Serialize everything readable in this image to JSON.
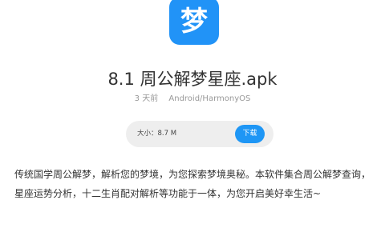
{
  "colors": {
    "accent": "#2193f7",
    "button": "#1e96f5",
    "text": "#333333",
    "muted": "#999999",
    "bar_bg": "#eeeeee"
  },
  "app": {
    "icon_name": "dream-logo-icon",
    "icon_glyph": "梦",
    "title": "8.1 周公解梦星座.apk",
    "time_ago": "3 天前",
    "platform": "Android/HarmonyOS"
  },
  "download": {
    "size_label": "大小：8.7 M",
    "button_label": "下载"
  },
  "description": "传统国学周公解梦，解析您的梦境，为您探索梦境奥秘。本软件集合周公解梦查询，星座运势分析，十二生肖配对解析等功能于一体，为您开启美好幸生活~"
}
